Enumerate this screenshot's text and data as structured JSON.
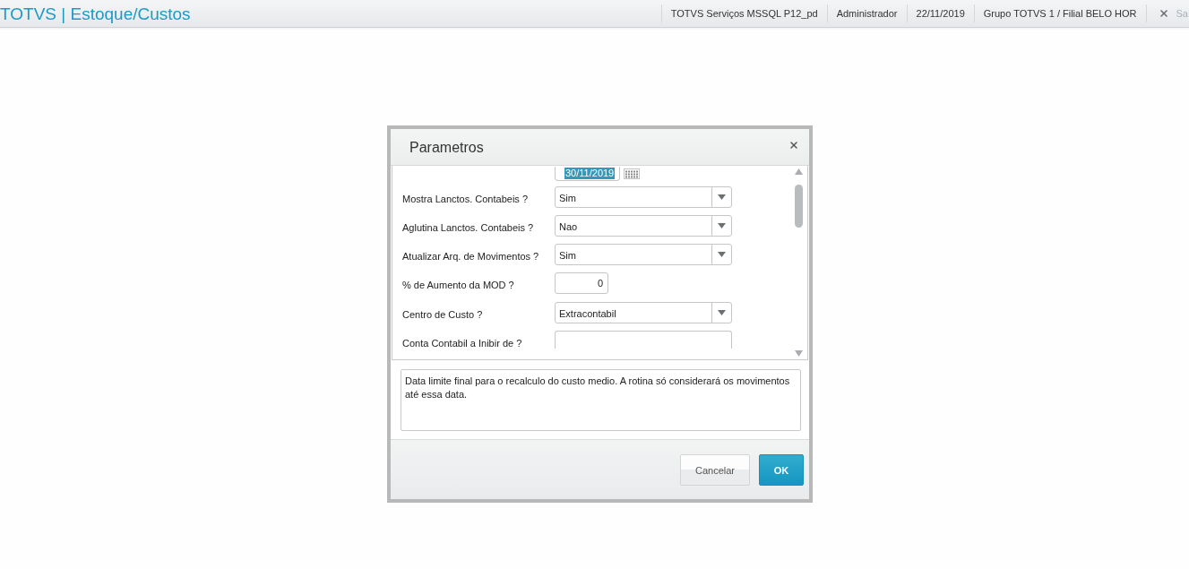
{
  "header": {
    "title": "TOTVS | Estoque/Custos",
    "info": [
      "TOTVS Serviços MSSQL P12_pd",
      "Administrador",
      "22/11/2019",
      "Grupo TOTVS 1 / Filial BELO HOR"
    ],
    "exit_label": "Sa"
  },
  "dialog": {
    "title": "Parametros",
    "fields": [
      {
        "kind": "date",
        "value": "30/11/2019",
        "highlighted": true
      },
      {
        "kind": "select",
        "label": "Mostra Lanctos. Contabeis ?",
        "value": "Sim"
      },
      {
        "kind": "select",
        "label": "Aglutina Lanctos. Contabeis ?",
        "value": "Nao"
      },
      {
        "kind": "select",
        "label": "Atualizar Arq. de Movimentos ?",
        "value": "Sim"
      },
      {
        "kind": "number",
        "label": "% de Aumento da MOD ?",
        "value": "0"
      },
      {
        "kind": "select",
        "label": "Centro de Custo ?",
        "value": "Extracontabil"
      },
      {
        "kind": "text",
        "label": "Conta Contabil a Inibir de ?"
      }
    ],
    "help": "Data limite final para o recalculo do custo medio. A rotina só considerará os movimentos até essa data.",
    "buttons": [
      {
        "kind": "secondary",
        "label": "Cancelar"
      },
      {
        "kind": "primary",
        "label": "OK"
      }
    ]
  }
}
